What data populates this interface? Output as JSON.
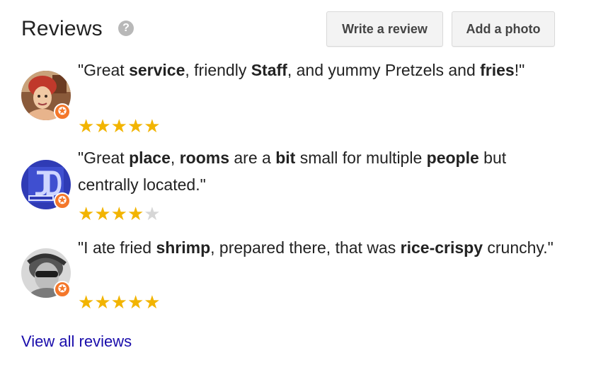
{
  "header": {
    "title": "Reviews",
    "help_icon": "?",
    "write_review_label": "Write a review",
    "add_photo_label": "Add a photo"
  },
  "reviews": [
    {
      "parts": [
        {
          "t": "\"Great ",
          "b": false
        },
        {
          "t": "service",
          "b": true
        },
        {
          "t": ", friendly ",
          "b": false
        },
        {
          "t": "Staff",
          "b": true
        },
        {
          "t": ", and yummy Pretzels and ",
          "b": false
        },
        {
          "t": "fries",
          "b": true
        },
        {
          "t": "!\"",
          "b": false
        }
      ],
      "rating": 5,
      "avatar": "avatar-woman-red-hair"
    },
    {
      "parts": [
        {
          "t": "\"Great ",
          "b": false
        },
        {
          "t": "place",
          "b": true
        },
        {
          "t": ", ",
          "b": false
        },
        {
          "t": "rooms",
          "b": true
        },
        {
          "t": " are a ",
          "b": false
        },
        {
          "t": "bit",
          "b": true
        },
        {
          "t": " small for multiple ",
          "b": false
        },
        {
          "t": "people",
          "b": true
        },
        {
          "t": " but centrally located.\"",
          "b": false
        }
      ],
      "rating": 4,
      "avatar": "avatar-jd-logo"
    },
    {
      "parts": [
        {
          "t": "\"I ate fried ",
          "b": false
        },
        {
          "t": "shrimp",
          "b": true
        },
        {
          "t": ", prepared there, that was ",
          "b": false
        },
        {
          "t": "rice-crispy",
          "b": true
        },
        {
          "t": " crunchy.\"",
          "b": false
        }
      ],
      "rating": 5,
      "avatar": "avatar-man-sunglasses"
    }
  ],
  "badge_icon": "local-guide-star-badge",
  "view_all_label": "View all reviews",
  "colors": {
    "star_filled": "#f2b400",
    "star_empty": "#d6d6d6",
    "badge": "#f4772a",
    "link": "#1a0dab"
  }
}
